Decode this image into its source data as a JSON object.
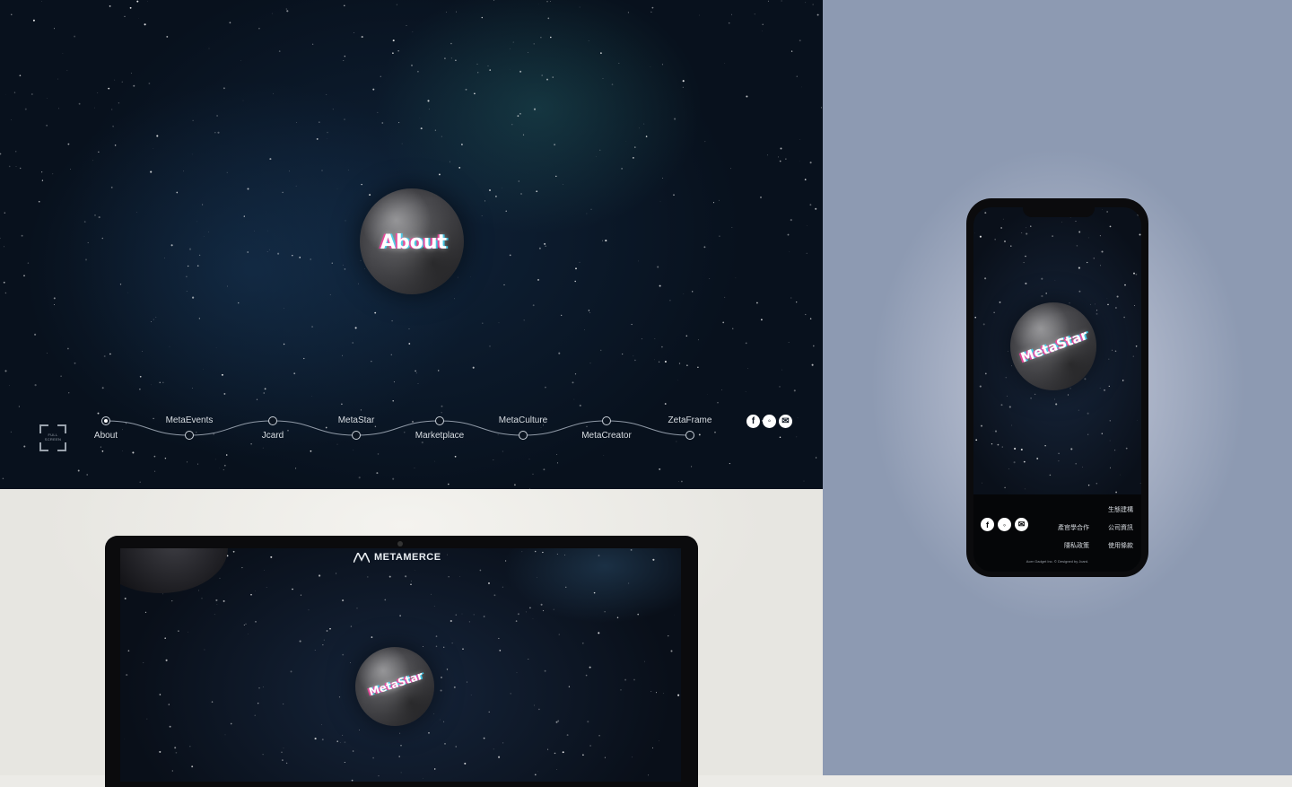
{
  "hero": {
    "planet_label": "About",
    "fullscreen_label_line1": "FULL",
    "fullscreen_label_line2": "SCREEN",
    "timeline": [
      {
        "label": "About",
        "active": true
      },
      {
        "label": "MetaEvents",
        "active": false
      },
      {
        "label": "Jcard",
        "active": false
      },
      {
        "label": "MetaStar",
        "active": false
      },
      {
        "label": "Marketplace",
        "active": false
      },
      {
        "label": "MetaCulture",
        "active": false
      },
      {
        "label": "MetaCreator",
        "active": false
      },
      {
        "label": "ZetaFrame",
        "active": false
      }
    ],
    "social_icons": [
      "facebook-icon",
      "line-icon",
      "mail-icon"
    ]
  },
  "laptop": {
    "brand": "METAMERCE",
    "planet_label": "MetaStar"
  },
  "phone": {
    "planet_label": "MetaStar",
    "footer": {
      "links": [
        "生態建構",
        "產官學合作",
        "公司資訊",
        "隱私政策",
        "使用條款"
      ],
      "copyright": "Acer Gadget Inc. © Designed by Jcard."
    }
  },
  "colors": {
    "space_dark": "#08111d",
    "phone_panel_bg": "#8d9ab2",
    "laptop_panel_bg": "#ecebe7"
  }
}
